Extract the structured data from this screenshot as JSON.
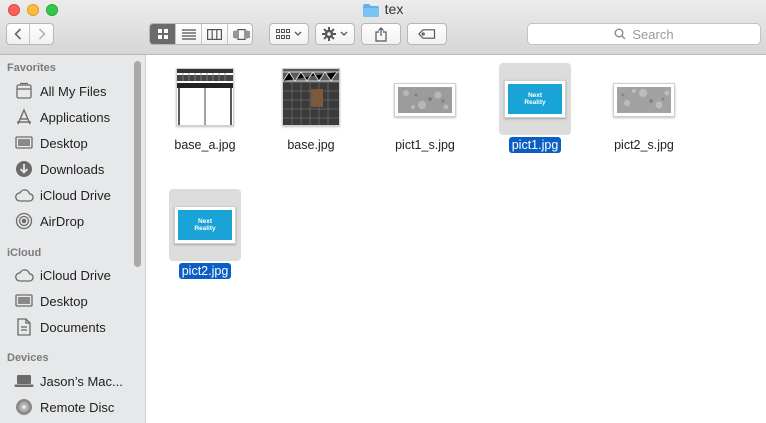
{
  "window": {
    "title": "tex"
  },
  "toolbar": {
    "back_icon": "chevron-left-icon",
    "forward_icon": "chevron-right-icon",
    "view_icons": [
      "icon-view-icon",
      "list-view-icon",
      "column-view-icon",
      "cover-flow-icon"
    ],
    "search_placeholder": "Search"
  },
  "sidebar": {
    "sections": [
      {
        "label": "Favorites",
        "items": [
          {
            "label": "All My Files",
            "icon": "all-files-icon"
          },
          {
            "label": "Applications",
            "icon": "applications-icon"
          },
          {
            "label": "Desktop",
            "icon": "desktop-icon"
          },
          {
            "label": "Downloads",
            "icon": "downloads-icon"
          },
          {
            "label": "iCloud Drive",
            "icon": "cloud-icon"
          },
          {
            "label": "AirDrop",
            "icon": "airdrop-icon"
          }
        ]
      },
      {
        "label": "iCloud",
        "items": [
          {
            "label": "iCloud Drive",
            "icon": "cloud-icon"
          },
          {
            "label": "Desktop",
            "icon": "desktop-icon"
          },
          {
            "label": "Documents",
            "icon": "documents-icon"
          }
        ]
      },
      {
        "label": "Devices",
        "items": [
          {
            "label": "Jason’s Mac...",
            "icon": "laptop-icon"
          },
          {
            "label": "Remote Disc",
            "icon": "disc-icon"
          }
        ]
      }
    ]
  },
  "files": [
    {
      "name": "base_a.jpg",
      "selected": false,
      "thumb": "base_a"
    },
    {
      "name": "base.jpg",
      "selected": false,
      "thumb": "base"
    },
    {
      "name": "pict1_s.jpg",
      "selected": false,
      "thumb": "concrete"
    },
    {
      "name": "pict1.jpg",
      "selected": true,
      "thumb": "logo",
      "logo_text": [
        "Next",
        "Reality"
      ]
    },
    {
      "name": "pict2_s.jpg",
      "selected": false,
      "thumb": "concrete"
    },
    {
      "name": "pict2.jpg",
      "selected": true,
      "thumb": "logo",
      "logo_text": [
        "Next",
        "Reality"
      ]
    }
  ],
  "colors": {
    "selection": "#0b5fc4",
    "logo_bg": "#1aa3d6"
  }
}
